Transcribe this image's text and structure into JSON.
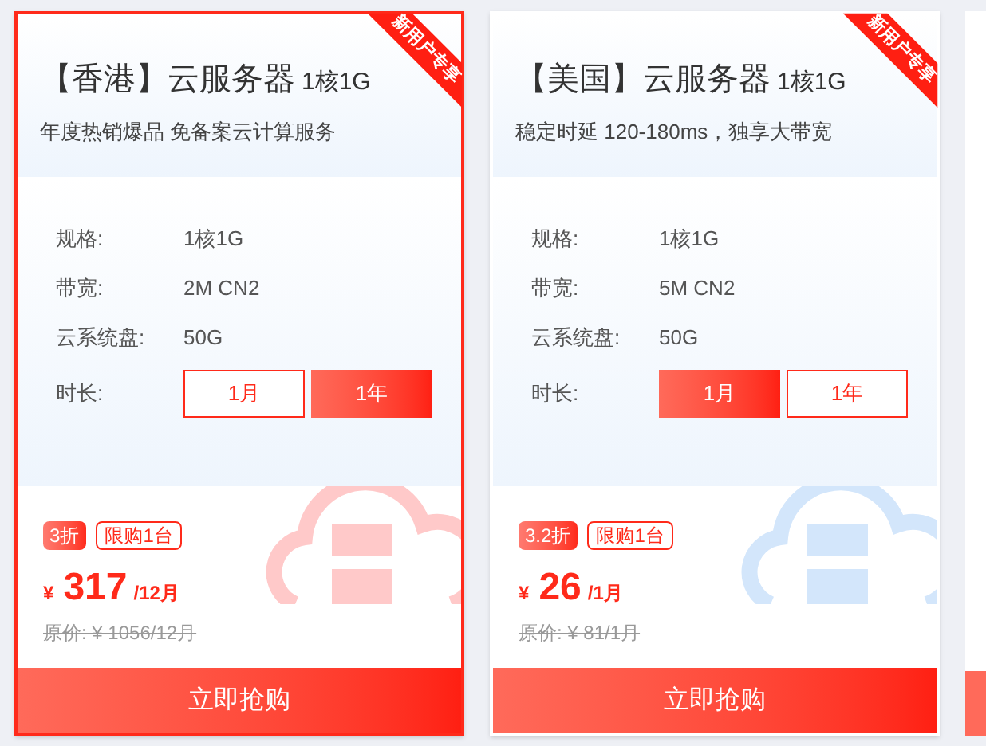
{
  "cards": [
    {
      "highlighted": true,
      "ribbon": "新用户专享",
      "region": "【香港】云服务器",
      "spec": "1核1G",
      "subtitle": "年度热销爆品 免备案云计算服务",
      "specs": [
        {
          "label": "规格:",
          "value": "1核1G"
        },
        {
          "label": "带宽:",
          "value": "2M CN2"
        },
        {
          "label": "云系统盘:",
          "value": "50G"
        }
      ],
      "duration_label": "时长:",
      "durations": [
        {
          "label": "1月",
          "selected": false
        },
        {
          "label": "1年",
          "selected": true
        }
      ],
      "discount": "3折",
      "limit": "限购1台",
      "currency": "¥",
      "price": "317",
      "period": "/12月",
      "original": "原价: ¥ 1056/12月",
      "color": "#ffc9c9",
      "buy": "立即抢购"
    },
    {
      "highlighted": false,
      "ribbon": "新用户专享",
      "region": "【美国】云服务器",
      "spec": "1核1G",
      "subtitle": "稳定时延 120-180ms，独享大带宽",
      "specs": [
        {
          "label": "规格:",
          "value": "1核1G"
        },
        {
          "label": "带宽:",
          "value": "5M CN2"
        },
        {
          "label": "云系统盘:",
          "value": "50G"
        }
      ],
      "duration_label": "时长:",
      "durations": [
        {
          "label": "1月",
          "selected": true
        },
        {
          "label": "1年",
          "selected": false
        }
      ],
      "discount": "3.2折",
      "limit": "限购1台",
      "currency": "¥",
      "price": "26",
      "period": "/1月",
      "original": "原价: ¥ 81/1月",
      "color": "#d3e6fb",
      "buy": "立即抢购"
    }
  ]
}
